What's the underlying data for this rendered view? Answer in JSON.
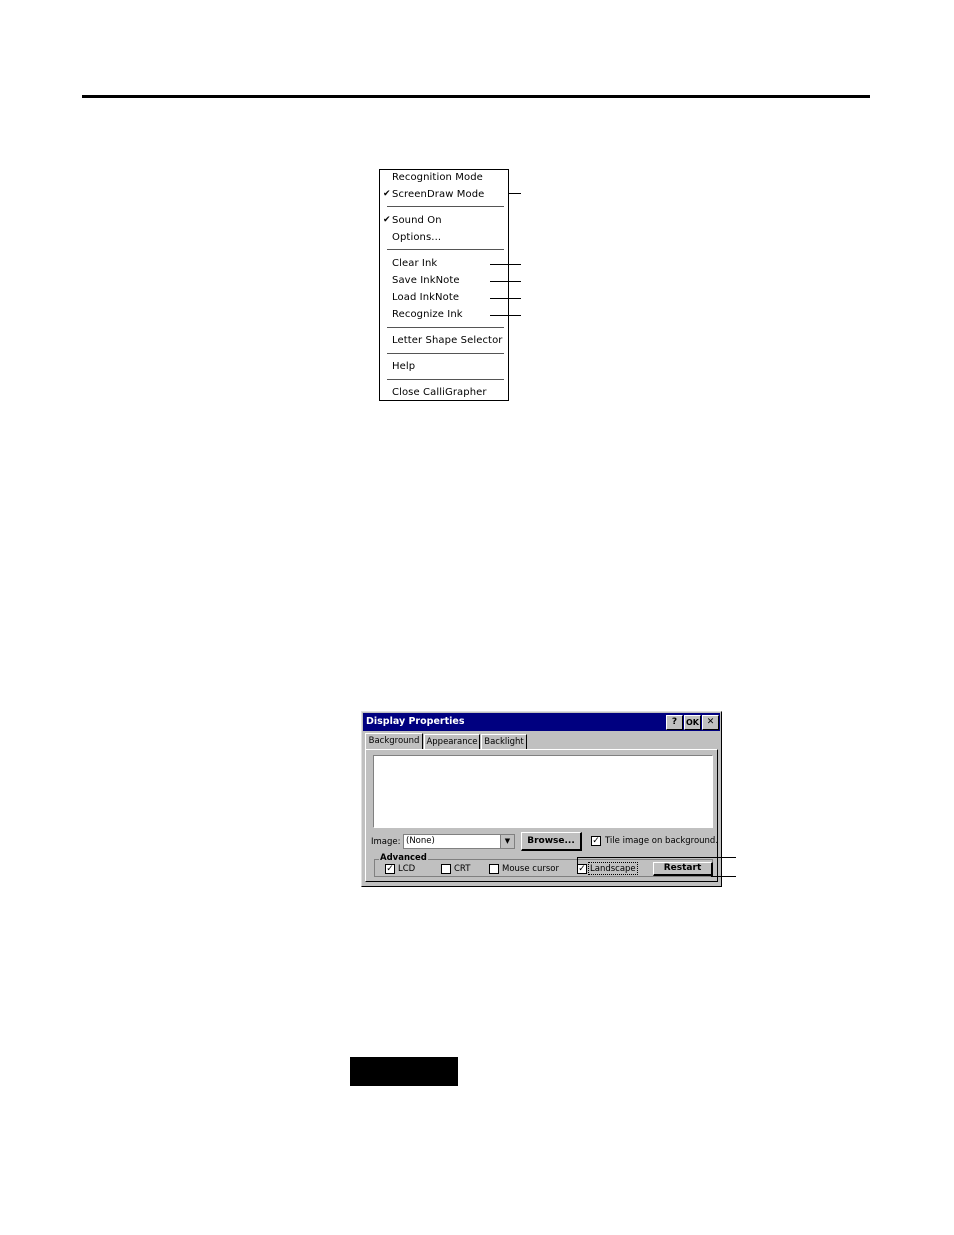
{
  "menu": {
    "items": [
      {
        "label": "Recognition Mode",
        "checked": false
      },
      {
        "label": "ScreenDraw Mode",
        "checked": true
      },
      {
        "label": "Sound On",
        "checked": true
      },
      {
        "label": "Options...",
        "checked": false
      },
      {
        "label": "Clear Ink",
        "checked": false
      },
      {
        "label": "Save InkNote",
        "checked": false
      },
      {
        "label": "Load InkNote",
        "checked": false
      },
      {
        "label": "Recognize Ink",
        "checked": false
      },
      {
        "label": "Letter Shape Selector",
        "checked": false
      },
      {
        "label": "Help",
        "checked": false
      },
      {
        "label": "Close CalliGrapher",
        "checked": false
      }
    ],
    "check_glyph": "✔"
  },
  "dialog": {
    "title": "Display Properties",
    "help_button": "?",
    "ok_button": "OK",
    "close_button": "✕",
    "tabs": [
      "Background",
      "Appearance",
      "Backlight"
    ],
    "image_label": "Image:",
    "image_value": "(None)",
    "browse_button": "Browse...",
    "tile_label": "Tile image on background.",
    "tile_checked": true,
    "advanced_title": "Advanced",
    "lcd_label": "LCD",
    "lcd_checked": true,
    "crt_label": "CRT",
    "crt_checked": false,
    "mouse_label": "Mouse cursor",
    "mouse_checked": false,
    "landscape_label": "Landscape",
    "landscape_checked": true,
    "restart_button": "Restart",
    "check_glyph": "✓"
  }
}
